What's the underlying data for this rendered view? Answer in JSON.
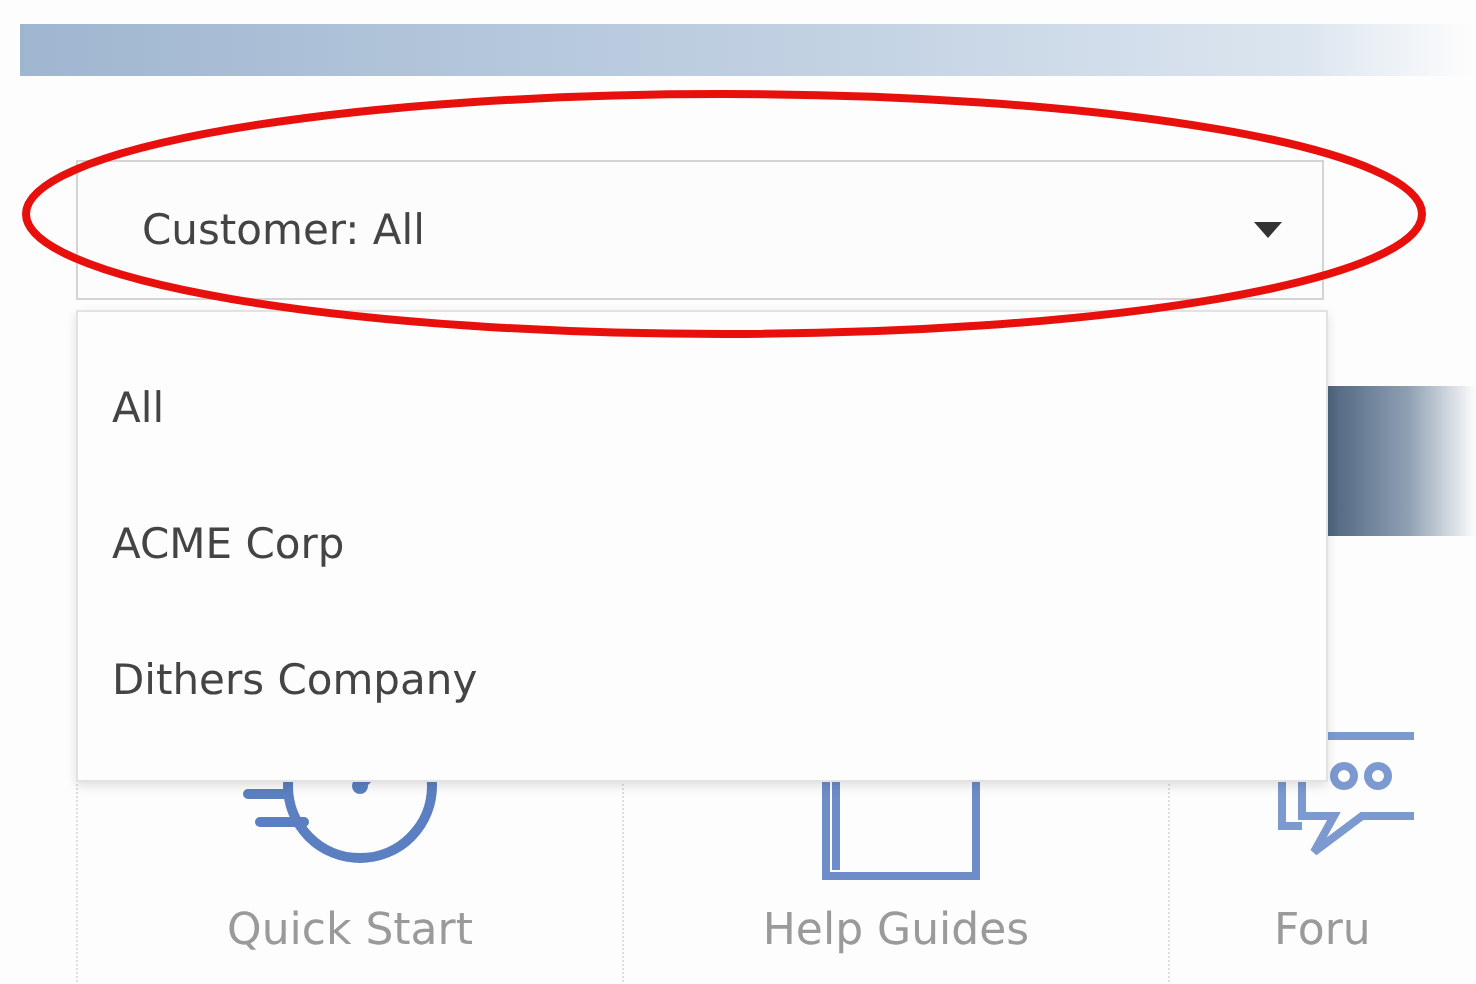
{
  "filter": {
    "value": "Customer: All"
  },
  "dropdown": {
    "options": [
      {
        "label": "All"
      },
      {
        "label": "ACME Corp"
      },
      {
        "label": "Dithers Company"
      }
    ]
  },
  "tiles": [
    {
      "kind": "stopwatch",
      "label": "Quick Start"
    },
    {
      "kind": "book",
      "label": "Help Guides"
    },
    {
      "kind": "chat",
      "label": "Foru"
    }
  ]
}
